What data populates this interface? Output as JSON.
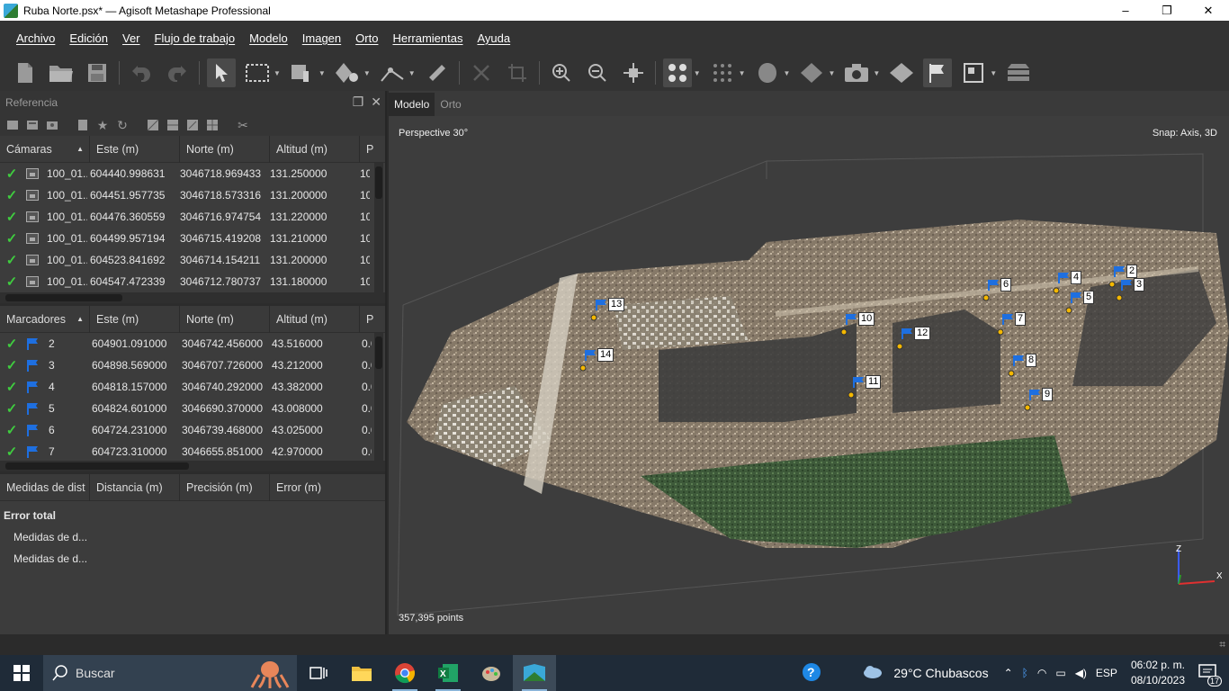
{
  "window": {
    "title": "Ruba Norte.psx* — Agisoft Metashape Professional",
    "min": "–",
    "max": "❐",
    "close": "✕"
  },
  "menu": [
    "Archivo",
    "Edición",
    "Ver",
    "Flujo de trabajo",
    "Modelo",
    "Imagen",
    "Orto",
    "Herramientas",
    "Ayuda"
  ],
  "reference": {
    "panel_title": "Referencia",
    "cameras": {
      "headers": [
        "Cámaras",
        "Este (m)",
        "Norte (m)",
        "Altitud (m)",
        "P"
      ],
      "rows": [
        {
          "label": "100_01...",
          "este": "604440.998631",
          "norte": "3046718.969433",
          "alt": "131.250000",
          "p": "10"
        },
        {
          "label": "100_01...",
          "este": "604451.957735",
          "norte": "3046718.573316",
          "alt": "131.200000",
          "p": "10"
        },
        {
          "label": "100_01...",
          "este": "604476.360559",
          "norte": "3046716.974754",
          "alt": "131.220000",
          "p": "10"
        },
        {
          "label": "100_01...",
          "este": "604499.957194",
          "norte": "3046715.419208",
          "alt": "131.210000",
          "p": "10"
        },
        {
          "label": "100_01...",
          "este": "604523.841692",
          "norte": "3046714.154211",
          "alt": "131.200000",
          "p": "10"
        },
        {
          "label": "100_01...",
          "este": "604547.472339",
          "norte": "3046712.780737",
          "alt": "131.180000",
          "p": "10"
        }
      ]
    },
    "markers": {
      "headers": [
        "Marcadores",
        "Este (m)",
        "Norte (m)",
        "Altitud (m)",
        "P"
      ],
      "rows": [
        {
          "label": "2",
          "este": "604901.091000",
          "norte": "3046742.456000",
          "alt": "43.516000",
          "p": "0.0"
        },
        {
          "label": "3",
          "este": "604898.569000",
          "norte": "3046707.726000",
          "alt": "43.212000",
          "p": "0.0"
        },
        {
          "label": "4",
          "este": "604818.157000",
          "norte": "3046740.292000",
          "alt": "43.382000",
          "p": "0.0"
        },
        {
          "label": "5",
          "este": "604824.601000",
          "norte": "3046690.370000",
          "alt": "43.008000",
          "p": "0.0"
        },
        {
          "label": "6",
          "este": "604724.231000",
          "norte": "3046739.468000",
          "alt": "43.025000",
          "p": "0.0"
        },
        {
          "label": "7",
          "este": "604723.310000",
          "norte": "3046655.851000",
          "alt": "42.970000",
          "p": "0.0"
        }
      ]
    },
    "distances": {
      "headers": [
        "Medidas de dist",
        "Distancia (m)",
        "Precisión (m)",
        "Error (m)"
      ],
      "total_label": "Error total",
      "rows": [
        "Medidas de d...",
        "Medidas de d..."
      ]
    }
  },
  "viewport": {
    "tabs": [
      "Modelo",
      "Orto"
    ],
    "projection": "Perspective 30°",
    "snap": "Snap: Axis, 3D",
    "points": "357,395 points",
    "markers": [
      "2",
      "3",
      "4",
      "5",
      "6",
      "7",
      "8",
      "9",
      "10",
      "11",
      "12",
      "13",
      "14"
    ],
    "axis_z": "Z",
    "axis_x": "X"
  },
  "taskbar": {
    "search_placeholder": "Buscar",
    "weather": "29°C  Chubascos",
    "lang": "ESP",
    "time": "06:02 p. m.",
    "date": "08/10/2023",
    "notif_count": "17"
  }
}
